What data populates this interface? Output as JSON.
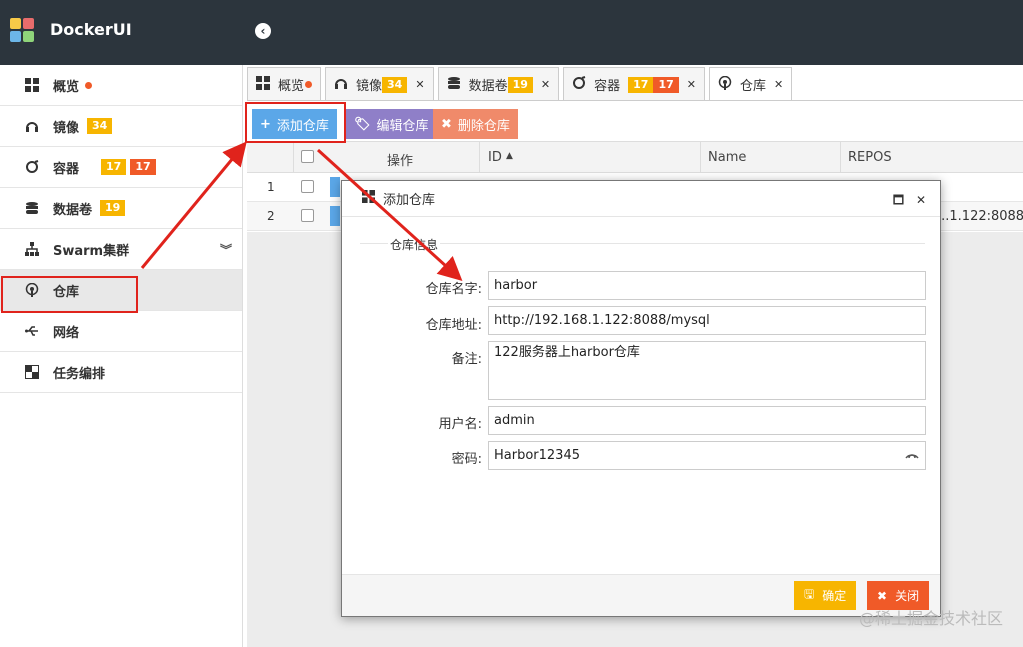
{
  "app": {
    "title": "DockerUI"
  },
  "sidebar": {
    "items": [
      {
        "label": "概览",
        "icon": "windows-icon"
      },
      {
        "label": "镜像",
        "icon": "headphones-icon",
        "badges": [
          "34"
        ]
      },
      {
        "label": "容器",
        "icon": "container-icon",
        "badges": [
          "17",
          "17"
        ]
      },
      {
        "label": "数据卷",
        "icon": "database-icon",
        "badges": [
          "19"
        ]
      },
      {
        "label": "Swarm集群",
        "icon": "sitemap-icon"
      },
      {
        "label": "仓库",
        "icon": "podcast-icon"
      },
      {
        "label": "网络",
        "icon": "usb-icon"
      },
      {
        "label": "任务编排",
        "icon": "tasks-icon"
      }
    ]
  },
  "tabs": [
    {
      "label": "概览"
    },
    {
      "label": "镜像",
      "badges": [
        "34"
      ]
    },
    {
      "label": "数据卷",
      "badges": [
        "19"
      ]
    },
    {
      "label": "容器",
      "badges": [
        "17",
        "17"
      ]
    },
    {
      "label": "仓库"
    }
  ],
  "toolbar": {
    "add_label": "添加仓库",
    "edit_label": "编辑仓库",
    "delete_label": "删除仓库"
  },
  "grid": {
    "columns": [
      "操作",
      "ID",
      "Name",
      "REPOS"
    ],
    "rows": [
      {
        "num": "1",
        "repos": ""
      },
      {
        "num": "2",
        "repos": "...1.122:8088/"
      }
    ]
  },
  "modal": {
    "title": "添加仓库",
    "section": "仓库信息",
    "fields": {
      "name": {
        "label": "仓库名字:",
        "value": "harbor"
      },
      "address": {
        "label": "仓库地址:",
        "value": "http://192.168.1.122:8088/mysql"
      },
      "remark": {
        "label": "备注:",
        "value": "122服务器上harbor仓库"
      },
      "username": {
        "label": "用户名:",
        "value": "admin"
      },
      "password": {
        "label": "密码:",
        "value": "Harbor12345"
      }
    },
    "confirm_label": "确定",
    "close_label": "关闭"
  },
  "watermark": "@稀土掘金技术社区",
  "colors": {
    "header": "#2c353d",
    "badge_yellow": "#f7b500",
    "badge_red": "#f05a28",
    "btn_add": "#5ba7e8",
    "btn_edit": "#8f7fc8",
    "btn_delete": "#f08a6a",
    "annotation_red": "#e0231c"
  }
}
